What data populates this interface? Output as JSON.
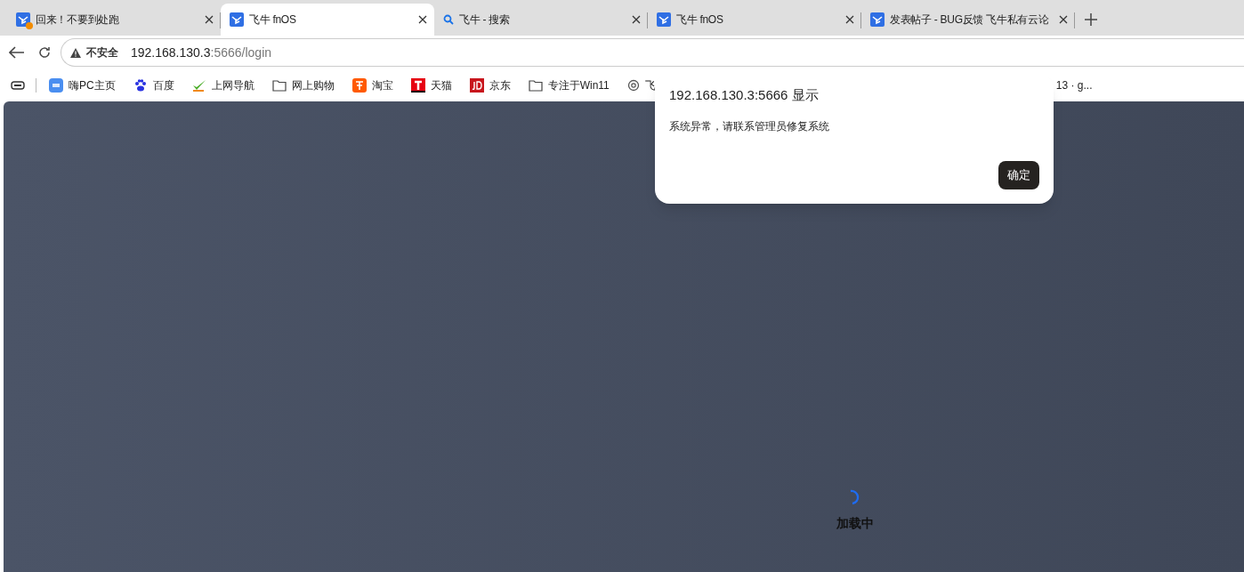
{
  "tabs": [
    {
      "title": "回来！不要到处跑",
      "kind": "app",
      "alert": true,
      "selected": false
    },
    {
      "title": "飞牛 fnOS",
      "kind": "app",
      "alert": false,
      "selected": true
    },
    {
      "title": "飞牛 - 搜索",
      "kind": "search",
      "alert": false,
      "selected": false
    },
    {
      "title": "飞牛 fnOS",
      "kind": "app",
      "alert": false,
      "selected": false
    },
    {
      "title": "发表帖子 - BUG反馈 飞牛私有云论",
      "kind": "app",
      "alert": false,
      "selected": false
    }
  ],
  "address": {
    "warning": "不安全",
    "host": "192.168.130.3",
    "path": ":5666/login"
  },
  "bookmarks": [
    {
      "label": "嗨PC主页",
      "kind": "hipc"
    },
    {
      "label": "百度",
      "kind": "paw"
    },
    {
      "label": "上网导航",
      "kind": "hao"
    },
    {
      "label": "网上购物",
      "kind": "folder"
    },
    {
      "label": "淘宝",
      "kind": "tao"
    },
    {
      "label": "天猫",
      "kind": "tmall"
    },
    {
      "label": "京东",
      "kind": "jd"
    },
    {
      "label": "专注于Win11",
      "kind": "folder"
    },
    {
      "label": "飞",
      "kind": "chat"
    },
    {
      "label": "13 · g...",
      "kind": "plain"
    }
  ],
  "dialog": {
    "title": "192.168.130.3:5666 显示",
    "message": "系统异常，请联系管理员修复系统",
    "button": "确定"
  },
  "loading": {
    "label": "加载中"
  }
}
